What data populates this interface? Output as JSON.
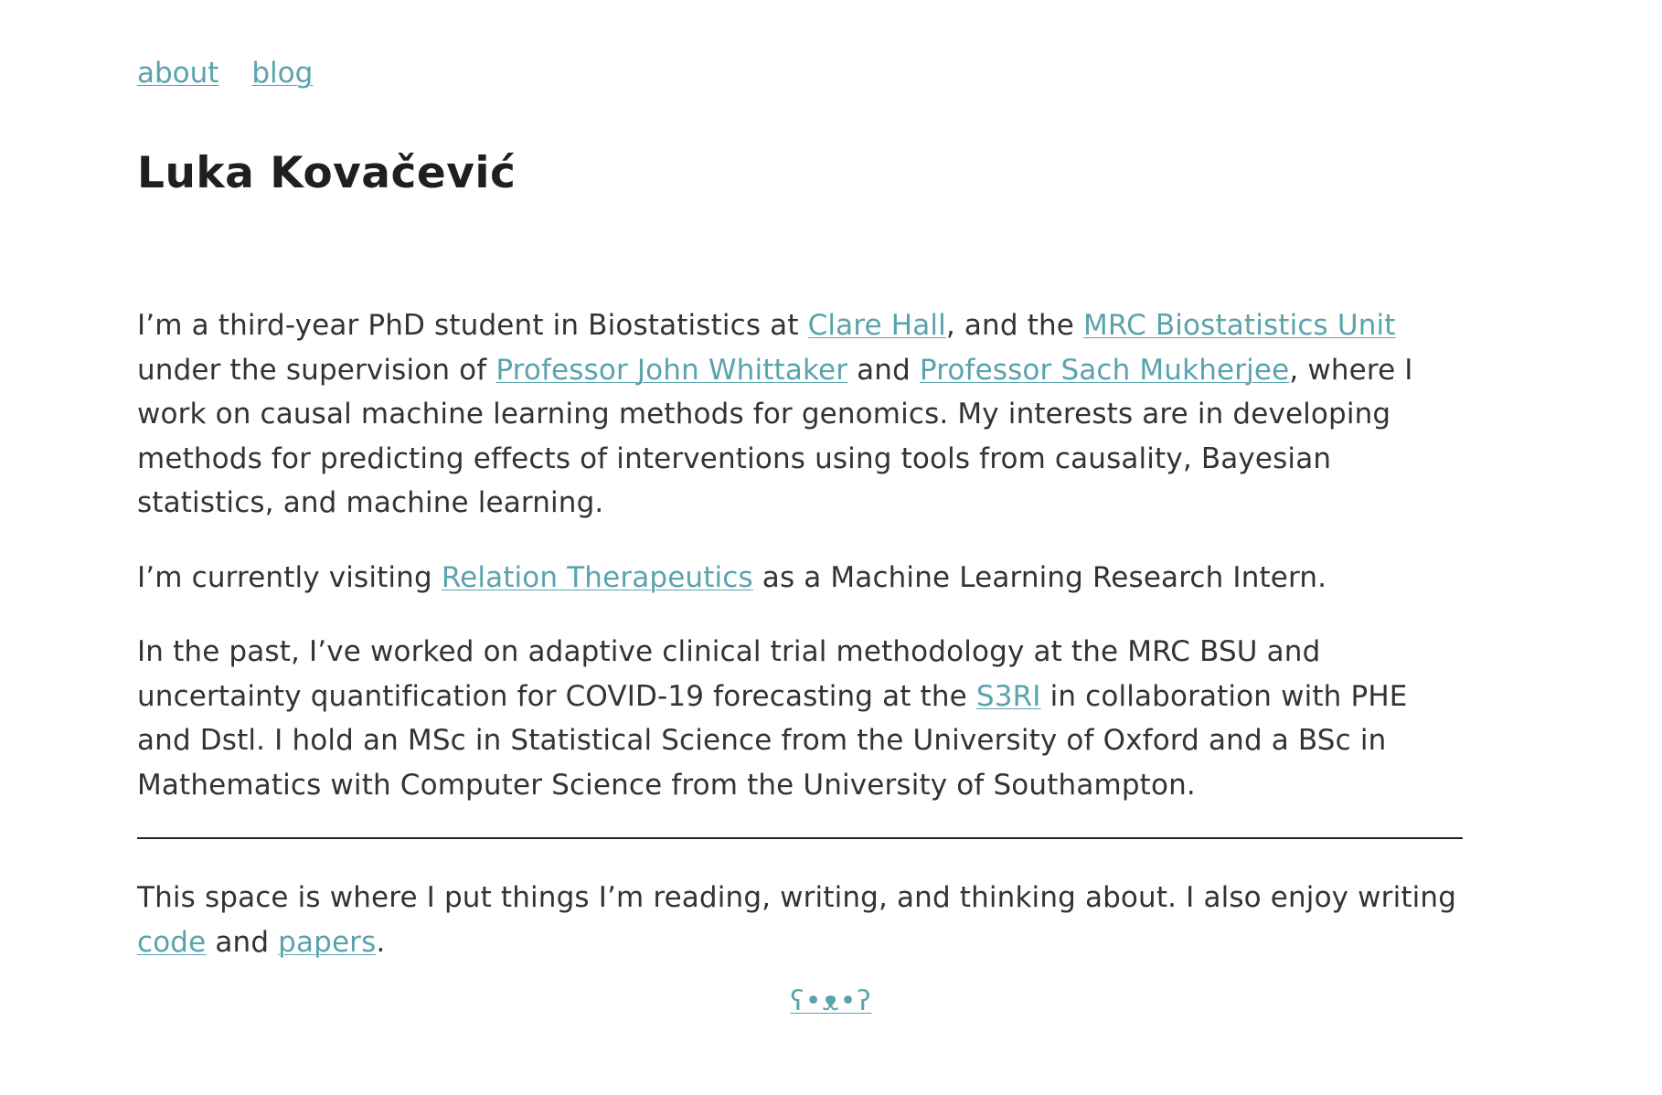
{
  "nav": {
    "about": "about",
    "blog": "blog"
  },
  "name": "Luka Kovačević",
  "intro": {
    "t1": "I’m a third-year PhD student in Biostatistics at ",
    "link_clare_hall": "Clare Hall",
    "t2": ", and the ",
    "link_mrc_bsu": "MRC Biostatistics Unit",
    "t3": " under the supervision of ",
    "link_whittaker": "Professor John Whittaker",
    "t4": " and ",
    "link_mukherjee": "Professor Sach Mukherjee",
    "t5": ", where I work on causal machine learning methods for genomics. My interests are in developing methods for predicting effects of interventions using tools from causality, Bayesian statistics, and machine learning."
  },
  "visiting": {
    "t1": "I’m currently visiting ",
    "link_relation": "Relation Therapeutics",
    "t2": " as a Machine Learning Research Intern."
  },
  "past": {
    "t1": "In the past, I’ve worked on adaptive clinical trial methodology at the MRC BSU and uncertainty quantification for COVID-19 forecasting at the ",
    "link_s3ri": "S3RI",
    "t2": " in collaboration with PHE and Dstl. I hold an MSc in Statistical Science from the University of Oxford and a BSc in Mathematics with Computer Science from the University of Southampton."
  },
  "space": {
    "t1": "This space is where I put things I’m reading, writing, and thinking about. I also enjoy writing ",
    "link_code": "code",
    "t2": " and ",
    "link_papers": "papers",
    "t3": "."
  },
  "footer": {
    "emoticon": "ʕ•ᴥ•ʔ"
  }
}
